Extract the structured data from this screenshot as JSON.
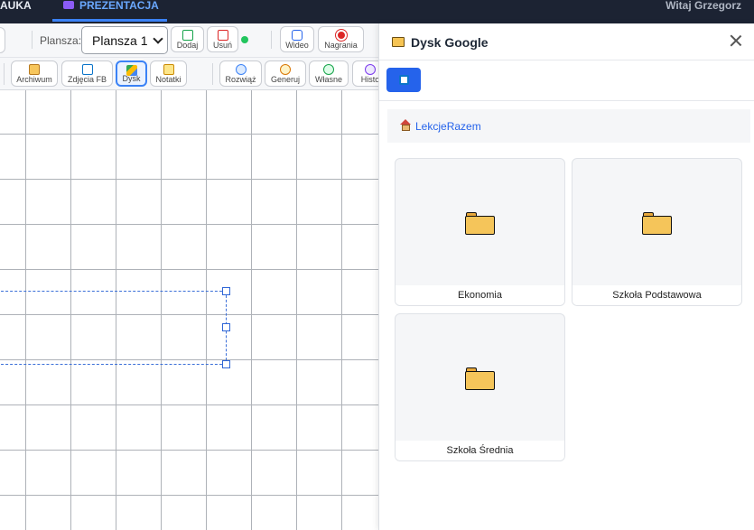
{
  "nav": {
    "tab_nauka": "AUKA",
    "tab_prezentacja": "PREZENTACJA",
    "greeting": "Witaj Grzegorz"
  },
  "toolbar1": {
    "plansza_label": "Plansza:",
    "plansza_value": "Plansza 1",
    "dodaj": "Dodaj",
    "usun": "Usuń",
    "wideo": "Wideo",
    "nagrania": "Nagrania"
  },
  "toolbar2": {
    "archiwum": "Archiwum",
    "zdjecia_fb": "Zdjęcia FB",
    "dysk": "Dysk",
    "notatki": "Notatki",
    "rozwiaz": "Rozwiąż",
    "generuj": "Generuj",
    "wlasne": "Własne",
    "historia": "Histo"
  },
  "panel": {
    "title": "Dysk Google",
    "breadcrumb": "LekcjeRazem",
    "folders": [
      "Ekonomia",
      "Szkoła Podstawowa",
      "Szkoła Średnia"
    ]
  },
  "colors": {
    "accent": "#2563eb",
    "nav_bg": "#1c2333",
    "folder": "#f5c55a"
  }
}
